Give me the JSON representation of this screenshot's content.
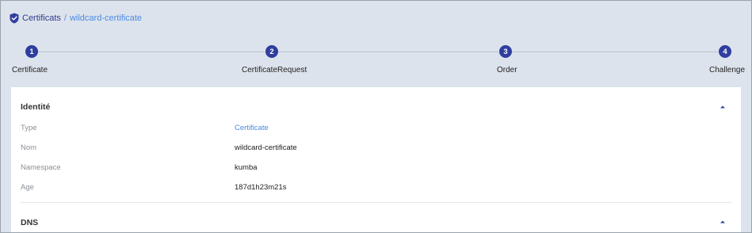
{
  "breadcrumb": {
    "root": "Certificats",
    "separator": "/",
    "current": "wildcard-certificate"
  },
  "colors": {
    "accent": "#2f3e9e",
    "link": "#4a8be3",
    "page_bg": "#dde3ec",
    "card_bg": "#ffffff"
  },
  "stepper": {
    "steps": [
      {
        "number": "1",
        "label": "Certificate"
      },
      {
        "number": "2",
        "label": "CertificateRequest"
      },
      {
        "number": "3",
        "label": "Order"
      },
      {
        "number": "4",
        "label": "Challenge"
      }
    ]
  },
  "identity": {
    "title": "Identité",
    "rows": [
      {
        "label": "Type",
        "value": "Certificate"
      },
      {
        "label": "Nom",
        "value": "wildcard-certificate"
      },
      {
        "label": "Namespace",
        "value": "kumba"
      },
      {
        "label": "Age",
        "value": "187d1h23m21s"
      }
    ]
  },
  "dns": {
    "title": "DNS"
  },
  "icons": {
    "breadcrumb": "shield-check-icon",
    "collapse": "chevron-up-icon"
  }
}
